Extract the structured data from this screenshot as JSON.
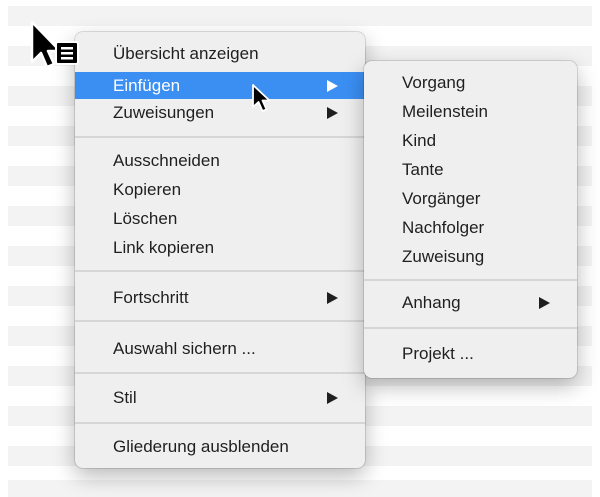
{
  "context_menu": {
    "items": [
      {
        "label": "Übersicht anzeigen"
      },
      {
        "label": "Einfügen",
        "has_submenu": true,
        "highlighted": true
      },
      {
        "label": "Zuweisungen",
        "has_submenu": true
      },
      {
        "label": "Ausschneiden"
      },
      {
        "label": "Kopieren"
      },
      {
        "label": "Löschen"
      },
      {
        "label": "Link kopieren"
      },
      {
        "label": "Fortschritt",
        "has_submenu": true
      },
      {
        "label": "Auswahl sichern ..."
      },
      {
        "label": "Stil",
        "has_submenu": true
      },
      {
        "label": "Gliederung ausblenden"
      }
    ]
  },
  "submenu_einfuegen": {
    "items": [
      {
        "label": "Vorgang"
      },
      {
        "label": "Meilenstein"
      },
      {
        "label": "Kind"
      },
      {
        "label": "Tante"
      },
      {
        "label": "Vorgänger"
      },
      {
        "label": "Nachfolger"
      },
      {
        "label": "Zuweisung"
      },
      {
        "label": "Anhang",
        "has_submenu": true
      },
      {
        "label": "Projekt ..."
      }
    ]
  },
  "colors": {
    "highlight": "#3b8ff3",
    "menu_background": "#efefef",
    "separator": "#d6d6d6"
  },
  "icons": {
    "context_menu_cursor": "context-menu-cursor-icon",
    "pointer_cursor": "arrow-pointer-icon",
    "submenu_arrow": "triangle-right-icon"
  }
}
